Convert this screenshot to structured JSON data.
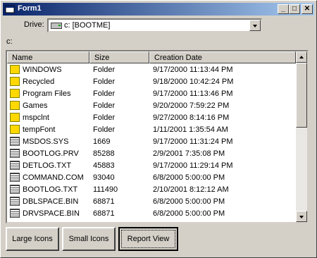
{
  "window": {
    "title": "Form1"
  },
  "title_buttons": {
    "minimize": "_",
    "maximize": "□",
    "close": "✕"
  },
  "drive": {
    "label": "Drive:",
    "value": "c: [BOOTME]"
  },
  "path": "c:",
  "columns": [
    "Name",
    "Size",
    "Creation Date"
  ],
  "rows": [
    {
      "icon": "folder",
      "name": "WINDOWS",
      "size": "Folder",
      "date": "9/17/2000 11:13:44 PM"
    },
    {
      "icon": "folder",
      "name": "Recycled",
      "size": "Folder",
      "date": "9/18/2000 10:42:24 PM"
    },
    {
      "icon": "folder",
      "name": "Program Files",
      "size": "Folder",
      "date": "9/17/2000 11:13:46 PM"
    },
    {
      "icon": "folder",
      "name": "Games",
      "size": "Folder",
      "date": "9/20/2000 7:59:22 PM"
    },
    {
      "icon": "folder",
      "name": "mspclnt",
      "size": "Folder",
      "date": "9/27/2000 8:14:16 PM"
    },
    {
      "icon": "folder",
      "name": "tempFont",
      "size": "Folder",
      "date": "1/11/2001 1:35:54 AM"
    },
    {
      "icon": "file",
      "name": "MSDOS.SYS",
      "size": "1669",
      "date": "9/17/2000 11:31:24 PM"
    },
    {
      "icon": "file",
      "name": "BOOTLOG.PRV",
      "size": "85288",
      "date": "2/9/2001 7:35:08 PM"
    },
    {
      "icon": "file",
      "name": "DETLOG.TXT",
      "size": "45883",
      "date": "9/17/2000 11:29:14 PM"
    },
    {
      "icon": "file",
      "name": "COMMAND.COM",
      "size": "93040",
      "date": "6/8/2000 5:00:00 PM"
    },
    {
      "icon": "file",
      "name": "BOOTLOG.TXT",
      "size": "111490",
      "date": "2/10/2001 8:12:12 AM"
    },
    {
      "icon": "file",
      "name": "DBLSPACE.BIN",
      "size": "68871",
      "date": "6/8/2000 5:00:00 PM"
    },
    {
      "icon": "file",
      "name": "DRVSPACE.BIN",
      "size": "68871",
      "date": "6/8/2000 5:00:00 PM"
    }
  ],
  "buttons": {
    "large_icons": "Large Icons",
    "small_icons": "Small Icons",
    "report_view": "Report View"
  }
}
